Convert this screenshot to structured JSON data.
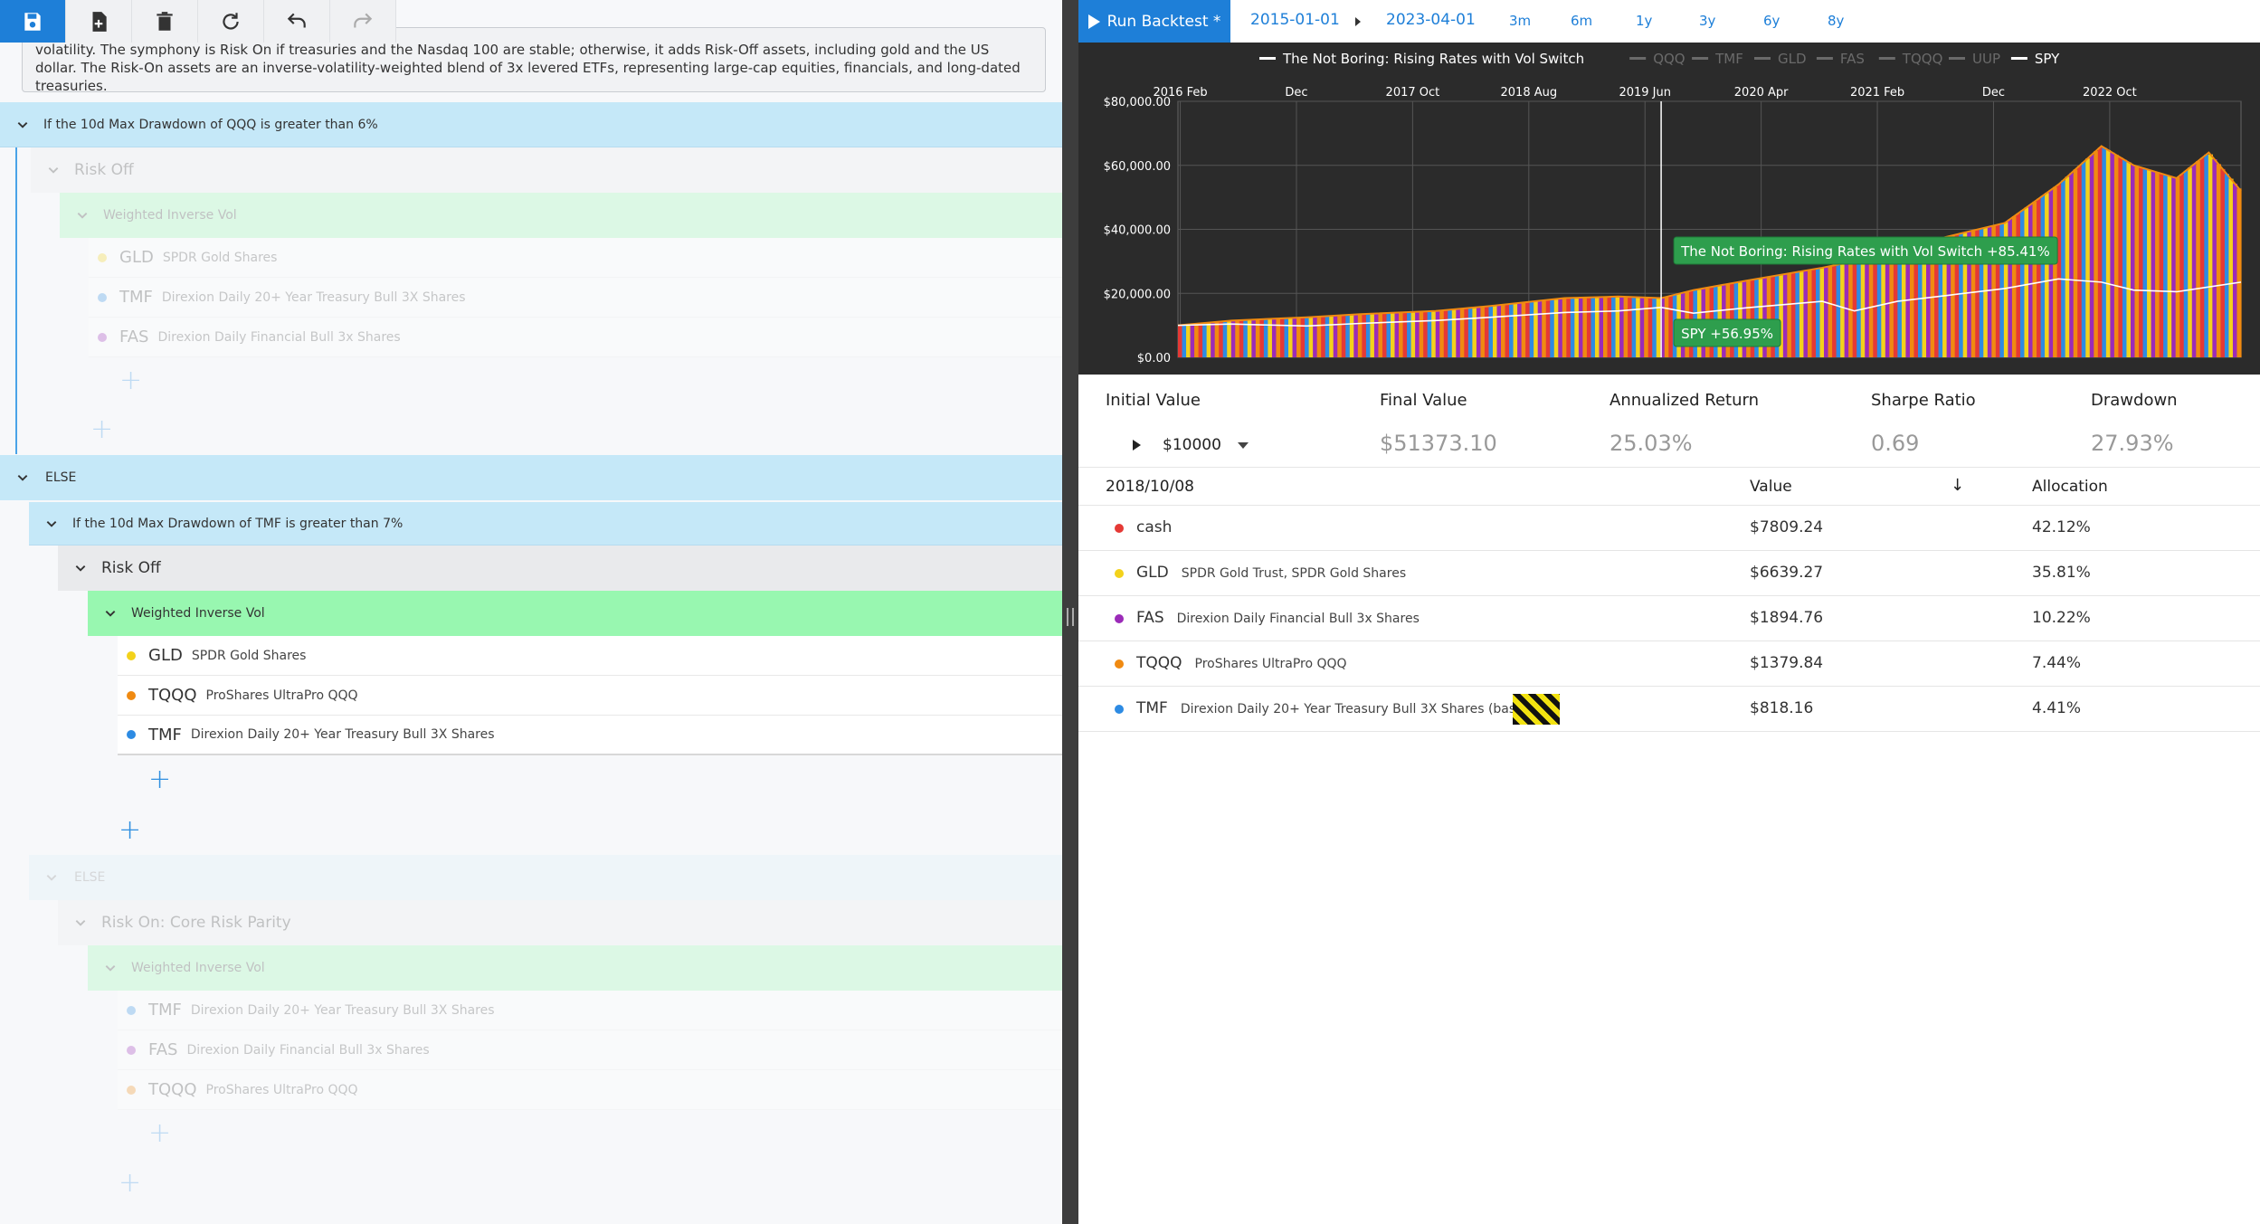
{
  "left": {
    "description": "volatility. The symphony is Risk On if treasuries and the Nasdaq 100 are stable; otherwise, it adds Risk-Off assets, including gold and the US dollar. The Risk-On assets are an inverse-volatility-weighted blend of 3x levered ETFs, representing large-cap equities, financials, and long-dated treasuries.",
    "if1": "If the 10d Max Drawdown of QQQ is greater than 6%",
    "riskoff1": "Risk Off",
    "wiv1": "Weighted Inverse Vol",
    "assets1": [
      {
        "ticker": "GLD",
        "name": "SPDR Gold Shares",
        "color": "#f3d21b"
      },
      {
        "ticker": "TMF",
        "name": "Direxion Daily 20+ Year Treasury Bull 3X Shares",
        "color": "#2d8be3"
      },
      {
        "ticker": "FAS",
        "name": "Direxion Daily Financial Bull 3x Shares",
        "color": "#9b2bb8"
      }
    ],
    "else1": "ELSE",
    "if2": "If the 10d Max Drawdown of TMF is greater than 7%",
    "riskoff2": "Risk Off",
    "wiv2": "Weighted Inverse Vol",
    "assets2": [
      {
        "ticker": "GLD",
        "name": "SPDR Gold Shares",
        "color": "#f3d21b"
      },
      {
        "ticker": "TQQQ",
        "name": "ProShares UltraPro QQQ",
        "color": "#f08a11"
      },
      {
        "ticker": "TMF",
        "name": "Direxion Daily 20+ Year Treasury Bull 3X Shares",
        "color": "#2d8be3"
      }
    ],
    "else2": "ELSE",
    "riskon": "Risk On: Core Risk Parity",
    "wiv3": "Weighted Inverse Vol",
    "assets3": [
      {
        "ticker": "TMF",
        "name": "Direxion Daily 20+ Year Treasury Bull 3X Shares",
        "color": "#2d8be3"
      },
      {
        "ticker": "FAS",
        "name": "Direxion Daily Financial Bull 3x Shares",
        "color": "#9b2bb8"
      },
      {
        "ticker": "TQQQ",
        "name": "ProShares UltraPro QQQ",
        "color": "#f08a11"
      }
    ],
    "plus": "+"
  },
  "topbar": {
    "run_label": "Run Backtest *",
    "start_date": "2015-01-01",
    "end_date": "2023-04-01",
    "ranges": [
      "3m",
      "6m",
      "1y",
      "3y",
      "6y",
      "8y"
    ]
  },
  "chart_data": {
    "type": "area",
    "legend": [
      {
        "name": "The Not Boring: Rising Rates with Vol Switch",
        "active": true
      },
      {
        "name": "QQQ",
        "active": false
      },
      {
        "name": "TMF",
        "active": false
      },
      {
        "name": "GLD",
        "active": false
      },
      {
        "name": "FAS",
        "active": false
      },
      {
        "name": "TQQQ",
        "active": false
      },
      {
        "name": "UUP",
        "active": false
      },
      {
        "name": "SPY",
        "active": true
      }
    ],
    "x_ticks": [
      "2016 Feb",
      "Dec",
      "2017 Oct",
      "2018 Aug",
      "2019 Jun",
      "2020 Apr",
      "2021 Feb",
      "Dec",
      "2022 Oct"
    ],
    "y_ticks": [
      "$0.00",
      "$20,000.00",
      "$40,000.00",
      "$60,000.00",
      "$80,000.00"
    ],
    "ylim": [
      0,
      80000
    ],
    "series": [
      {
        "name": "The Not Boring: Rising Rates with Vol Switch",
        "x": [
          "2015-01",
          "2015-06",
          "2016-01",
          "2016-06",
          "2017-01",
          "2017-06",
          "2018-01",
          "2018-06",
          "2018-10",
          "2019-01",
          "2019-06",
          "2020-01",
          "2020-04",
          "2020-08",
          "2021-01",
          "2021-06",
          "2021-11",
          "2022-03",
          "2022-06",
          "2022-10",
          "2023-01",
          "2023-04"
        ],
        "values": [
          10000,
          11500,
          12500,
          13500,
          14500,
          16000,
          18500,
          19000,
          18500,
          21000,
          24000,
          28000,
          30000,
          34000,
          38000,
          42000,
          54000,
          66000,
          60000,
          56000,
          64000,
          52000
        ]
      },
      {
        "name": "SPY",
        "x": [
          "2015-01",
          "2015-06",
          "2016-01",
          "2016-06",
          "2017-01",
          "2017-06",
          "2018-01",
          "2018-06",
          "2018-10",
          "2019-01",
          "2019-06",
          "2020-01",
          "2020-04",
          "2020-08",
          "2021-01",
          "2021-06",
          "2021-11",
          "2022-03",
          "2022-06",
          "2022-10",
          "2023-01",
          "2023-04"
        ],
        "values": [
          10000,
          10400,
          9800,
          10600,
          11500,
          12500,
          14000,
          14500,
          15600,
          13800,
          15500,
          17500,
          14500,
          17500,
          19500,
          21500,
          24500,
          23500,
          21000,
          20500,
          22000,
          23500
        ]
      }
    ],
    "tooltips": [
      {
        "label": "The Not Boring: Rising Rates with Vol Switch +85.41%"
      },
      {
        "label": "SPY +56.95%"
      }
    ]
  },
  "stats": {
    "headers": [
      "Initial Value",
      "Final Value",
      "Annualized Return",
      "Sharpe Ratio",
      "Drawdown"
    ],
    "initial_value": "$10000",
    "final_value": "$51373.10",
    "annualized_return": "25.03%",
    "sharpe_ratio": "0.69",
    "drawdown": "27.93%"
  },
  "holdings": {
    "date": "2018/10/08",
    "value_header": "Value",
    "alloc_header": "Allocation",
    "sort_icon": "↓",
    "rows": [
      {
        "ticker": "cash",
        "name": "",
        "value": "$7809.24",
        "alloc": "42.12%",
        "color": "#e53935"
      },
      {
        "ticker": "GLD",
        "name": "SPDR Gold Trust, SPDR Gold Shares",
        "value": "$6639.27",
        "alloc": "35.81%",
        "color": "#f3d21b"
      },
      {
        "ticker": "FAS",
        "name": "Direxion Daily Financial Bull 3x Shares",
        "value": "$1894.76",
        "alloc": "10.22%",
        "color": "#9b2bb8"
      },
      {
        "ticker": "TQQQ",
        "name": "ProShares UltraPro QQQ",
        "value": "$1379.84",
        "alloc": "7.44%",
        "color": "#f08a11"
      },
      {
        "ticker": "TMF",
        "name": "Direxion Daily 20+ Year Treasury Bull 3X Shares (based o",
        "value": "$818.16",
        "alloc": "4.41%",
        "color": "#2d8be3"
      }
    ]
  }
}
